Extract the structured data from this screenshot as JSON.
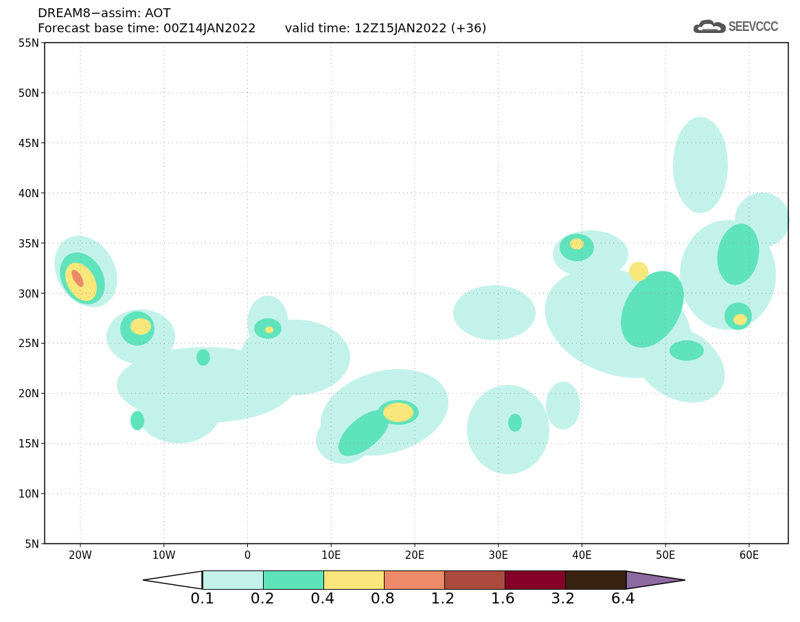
{
  "header": {
    "title": "DREAM8−assim: AOT",
    "base_time": "Forecast base time: 00Z14JAN2022",
    "valid_time": "valid time: 12Z15JAN2022 (+36)",
    "logo_text": "SEEVCCC"
  },
  "map": {
    "y_labels": [
      "55N",
      "50N",
      "45N",
      "40N",
      "35N",
      "30N",
      "25N",
      "20N",
      "15N",
      "10N",
      "5N"
    ],
    "x_labels": [
      "20W",
      "10W",
      "0",
      "10E",
      "20E",
      "30E",
      "40E",
      "50E",
      "60E"
    ]
  },
  "colorbar": {
    "ends": [
      {
        "kind": "under",
        "color": "#ffffff"
      },
      {
        "kind": "over",
        "color": "#8d6aa0"
      }
    ],
    "bins": [
      {
        "color": "#c3f2ea"
      },
      {
        "color": "#5fe3bb"
      },
      {
        "color": "#f9e77c"
      },
      {
        "color": "#ec8a6a"
      },
      {
        "color": "#ac4a40"
      },
      {
        "color": "#840028"
      },
      {
        "color": "#3a2211"
      }
    ],
    "labels": [
      "0.1",
      "0.2",
      "0.4",
      "0.8",
      "1.2",
      "1.6",
      "3.2",
      "6.4"
    ]
  }
}
